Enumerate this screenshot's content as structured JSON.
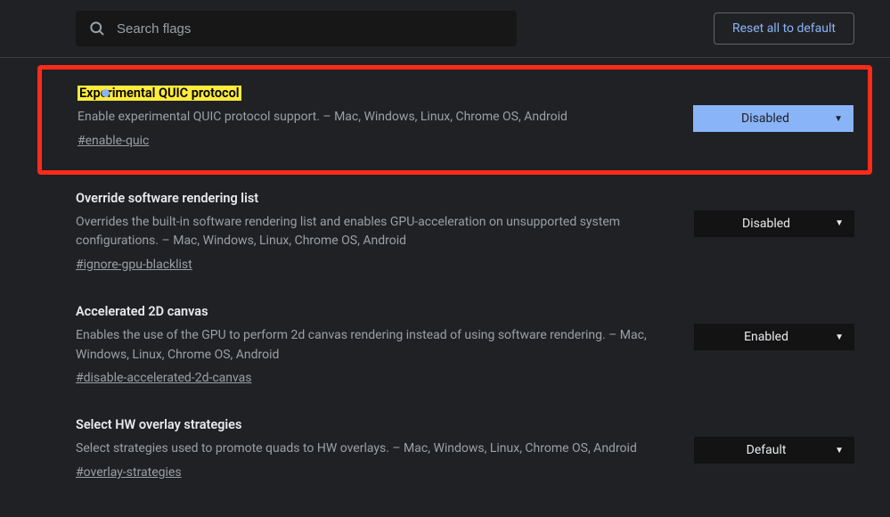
{
  "header": {
    "search_placeholder": "Search flags",
    "reset_label": "Reset all to default"
  },
  "flags": [
    {
      "title": "Experimental QUIC protocol",
      "description": "Enable experimental QUIC protocol support. – Mac, Windows, Linux, Chrome OS, Android",
      "hash": "#enable-quic",
      "select_value": "Disabled",
      "highlighted": true,
      "yellow_title": true,
      "dot": true,
      "select_active": true
    },
    {
      "title": "Override software rendering list",
      "description": "Overrides the built-in software rendering list and enables GPU-acceleration on unsupported system configurations. – Mac, Windows, Linux, Chrome OS, Android",
      "hash": "#ignore-gpu-blacklist",
      "select_value": "Disabled"
    },
    {
      "title": "Accelerated 2D canvas",
      "description": "Enables the use of the GPU to perform 2d canvas rendering instead of using software rendering. – Mac, Windows, Linux, Chrome OS, Android",
      "hash": "#disable-accelerated-2d-canvas",
      "select_value": "Enabled"
    },
    {
      "title": "Select HW overlay strategies",
      "description": "Select strategies used to promote quads to HW overlays. – Mac, Windows, Linux, Chrome OS, Android",
      "hash": "#overlay-strategies",
      "select_value": "Default"
    }
  ]
}
